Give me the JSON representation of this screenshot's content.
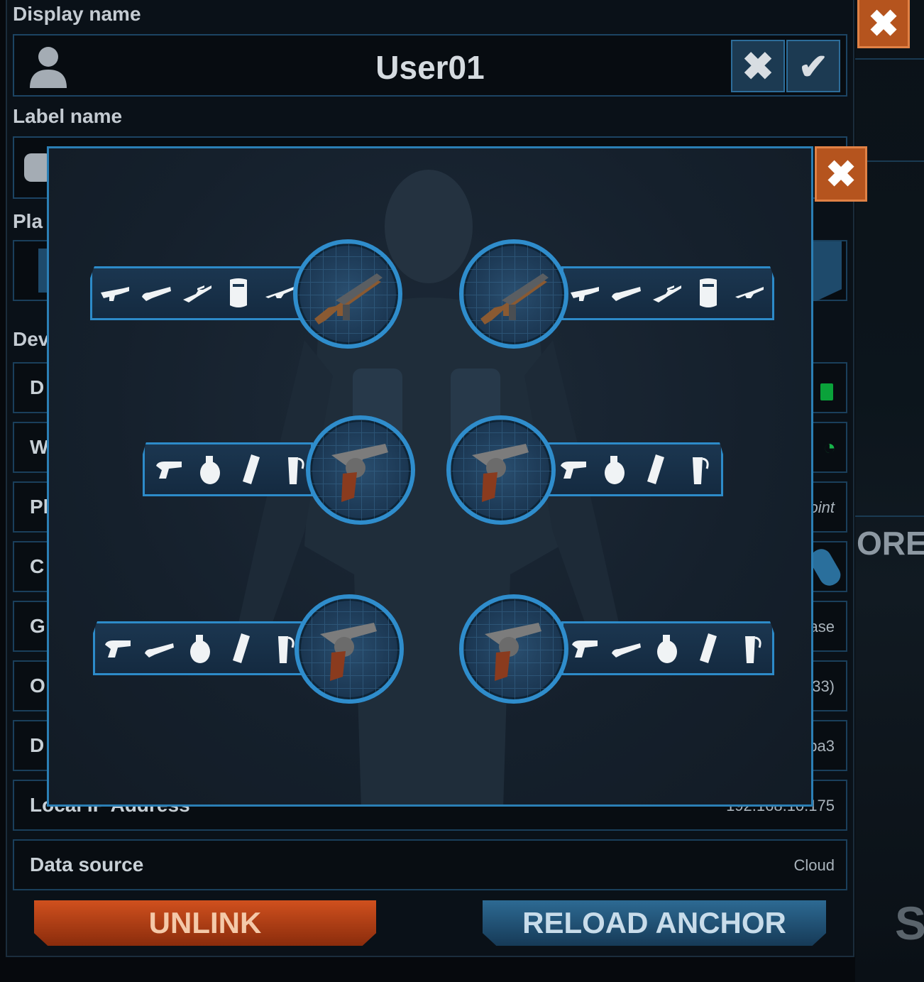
{
  "profile": {
    "display_name_label": "Display name",
    "display_name_value": "User01",
    "label_name_label": "Label name",
    "player_label_partial": "Pla",
    "device_label_partial": "Dev"
  },
  "rows": [
    {
      "name": "D",
      "value": ""
    },
    {
      "name": "W",
      "value": ""
    },
    {
      "name": "Pl",
      "value": "oint"
    },
    {
      "name": "C",
      "value": ""
    },
    {
      "name": "G",
      "value": "ase"
    },
    {
      "name": "O",
      "value": "33)"
    },
    {
      "name": "D",
      "value": "ba3"
    },
    {
      "name": "Local IP Address",
      "value": "192.168.10.175"
    },
    {
      "name": "Data source",
      "value": "Cloud"
    }
  ],
  "buttons": {
    "unlink": "UNLINK",
    "reload_anchor": "RELOAD ANCHOR"
  },
  "right_edge": {
    "partial_text": "ORE",
    "partial_letter": "S"
  },
  "colors": {
    "accent_blue": "#2d8bc9",
    "close_orange": "#b5541e",
    "unlink_orange": "#c14a1a",
    "reload_blue": "#235b82"
  },
  "loadout_slots": [
    {
      "side": "left",
      "main": "tommy-gun-icon",
      "options": [
        "smg-icon",
        "shotgun-icon",
        "sniper-rifle-icon",
        "riot-shield-icon",
        "assault-rifle-icon"
      ]
    },
    {
      "side": "right",
      "main": "tommy-gun-icon",
      "options": [
        "smg-icon",
        "shotgun-icon",
        "sniper-rifle-icon",
        "riot-shield-icon",
        "assault-rifle-icon"
      ]
    },
    {
      "side": "left",
      "main": "revolver-icon",
      "options": [
        "pistol-icon",
        "grenade-icon",
        "flashbang-icon",
        "smoke-grenade-icon"
      ]
    },
    {
      "side": "right",
      "main": "revolver-icon",
      "options": [
        "pistol-icon",
        "grenade-icon",
        "flashbang-icon",
        "smoke-grenade-icon"
      ]
    },
    {
      "side": "left",
      "main": "revolver-icon",
      "options": [
        "pistol-icon",
        "sawed-off-icon",
        "grenade-icon",
        "flashbang-icon",
        "smoke-grenade-icon"
      ]
    },
    {
      "side": "right",
      "main": "revolver-icon",
      "options": [
        "pistol-icon",
        "sawed-off-icon",
        "grenade-icon",
        "flashbang-icon",
        "smoke-grenade-icon"
      ]
    }
  ]
}
